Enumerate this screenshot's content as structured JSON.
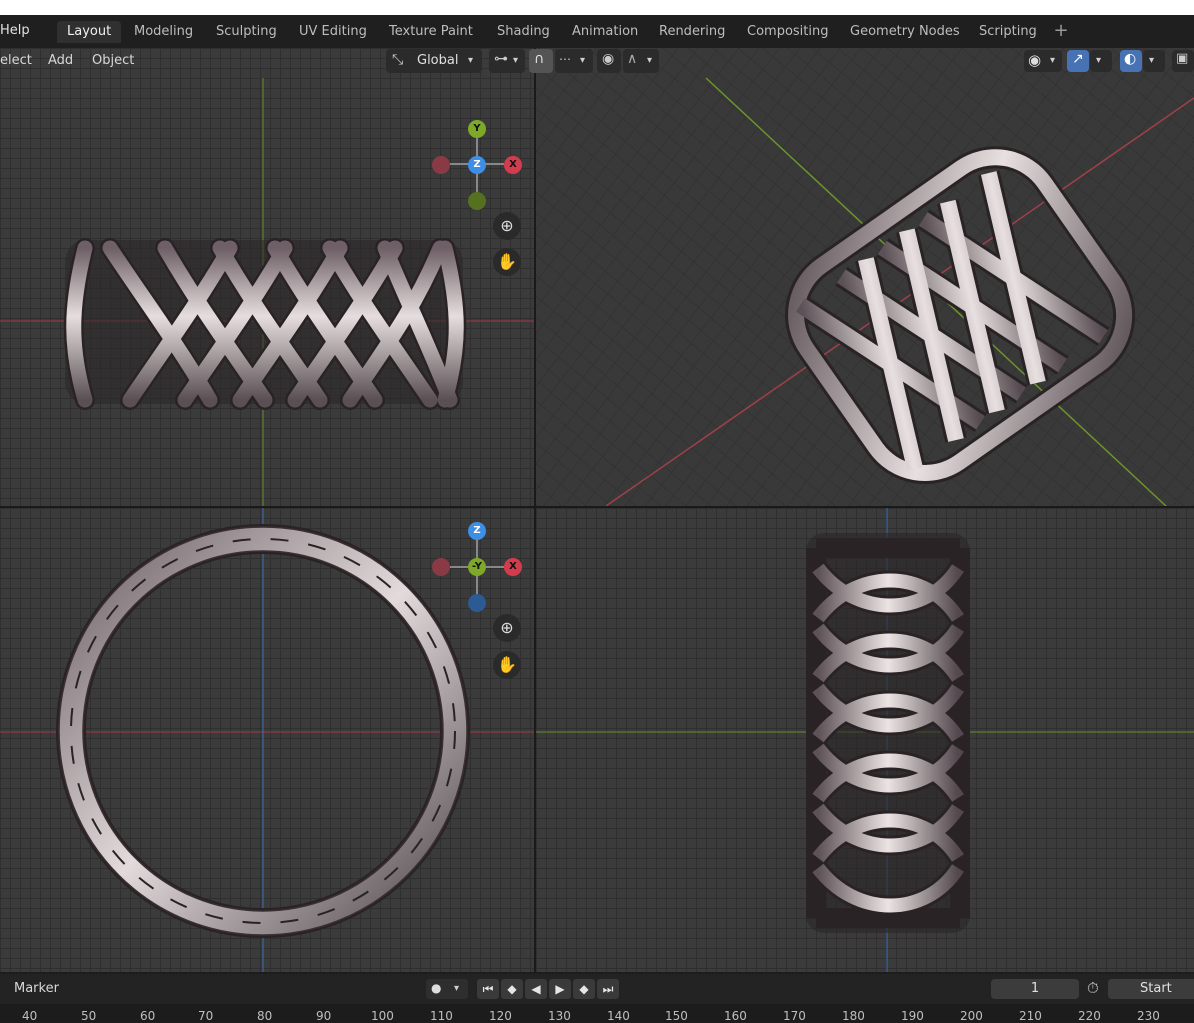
{
  "menu": {
    "help": "Help"
  },
  "workspaces": [
    "Layout",
    "Modeling",
    "Sculpting",
    "UV Editing",
    "Texture Paint",
    "Shading",
    "Animation",
    "Rendering",
    "Compositing",
    "Geometry Nodes",
    "Scripting"
  ],
  "active_workspace": "Layout",
  "viewport_header": {
    "select_label": "elect",
    "add_label": "Add",
    "object_label": "Object",
    "transform_orientation": "Global"
  },
  "gizmo_top": {
    "y": "Y",
    "z": "Z",
    "x": "X"
  },
  "gizmo_front": {
    "z": "Z",
    "neg_y": "-Y",
    "x": "X"
  },
  "timeline": {
    "marker_label": "Marker",
    "current_frame": "1",
    "start_label": "Start",
    "ruler_ticks": [
      "40",
      "50",
      "60",
      "70",
      "80",
      "90",
      "100",
      "110",
      "120",
      "130",
      "140",
      "150",
      "160",
      "170",
      "180",
      "190",
      "200",
      "210",
      "220",
      "230"
    ]
  },
  "colors": {
    "axis_red": "#d33c4d",
    "axis_green": "#7ea828",
    "axis_blue": "#3d8ee5",
    "active_blue": "#4772b3"
  }
}
